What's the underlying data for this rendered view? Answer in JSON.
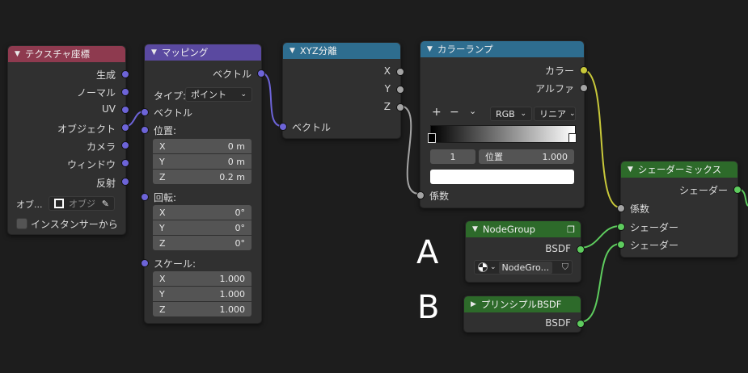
{
  "nodes": {
    "texcoord": {
      "title": "テクスチャ座標",
      "outputs": [
        "生成",
        "ノーマル",
        "UV",
        "オブジェクト",
        "カメラ",
        "ウィンドウ",
        "反射"
      ],
      "object_label": "オブ...",
      "object_placeholder": "オブジ",
      "from_instancer": "インスタンサーから"
    },
    "mapping": {
      "title": "マッピング",
      "output_vector": "ベクトル",
      "type_label": "タイプ:",
      "type_value": "ポイント",
      "input_vector": "ベクトル",
      "location_label": "位置:",
      "location": [
        {
          "axis": "X",
          "value": "0 m"
        },
        {
          "axis": "Y",
          "value": "0 m"
        },
        {
          "axis": "Z",
          "value": "0.2 m"
        }
      ],
      "rotation_label": "回転:",
      "rotation": [
        {
          "axis": "X",
          "value": "0°"
        },
        {
          "axis": "Y",
          "value": "0°"
        },
        {
          "axis": "Z",
          "value": "0°"
        }
      ],
      "scale_label": "スケール:",
      "scale": [
        {
          "axis": "X",
          "value": "1.000"
        },
        {
          "axis": "Y",
          "value": "1.000"
        },
        {
          "axis": "Z",
          "value": "1.000"
        }
      ]
    },
    "separate_xyz": {
      "title": "XYZ分離",
      "outputs": [
        "X",
        "Y",
        "Z"
      ],
      "input_vector": "ベクトル"
    },
    "color_ramp": {
      "title": "カラーランプ",
      "output_color": "カラー",
      "output_alpha": "アルファ",
      "add": "+",
      "remove": "−",
      "mode": "RGB",
      "interpolation": "リニア",
      "stop_index": "1",
      "pos_label": "位置",
      "pos_value": "1.000",
      "input_fac": "係数"
    },
    "nodegroup": {
      "title": "NodeGroup",
      "output": "BSDF",
      "datablock": "NodeGro..."
    },
    "principled": {
      "title": "プリンシプルBSDF",
      "output": "BSDF"
    },
    "mix_shader": {
      "title": "シェーダーミックス",
      "output": "シェーダー",
      "input_fac": "係数",
      "input_shader1": "シェーダー",
      "input_shader2": "シェーダー"
    }
  },
  "annotations": {
    "a": "A",
    "b": "B"
  },
  "colors": {
    "bg": "#1d1d1d",
    "tex_header": "#8e3a4f",
    "vector_header": "#5a49a0",
    "converter_header": "#2e6d8f",
    "shader_header": "#2d6a2a",
    "vector_socket": "#6d64d8",
    "float_socket": "#a4a4a4",
    "color_socket": "#c8c83a",
    "shader_socket": "#5ecc5e"
  },
  "icons": [
    "chevron-down-icon",
    "eyedropper-icon",
    "object-icon",
    "sphere-icon",
    "shield-icon",
    "nodegroup-icon"
  ]
}
